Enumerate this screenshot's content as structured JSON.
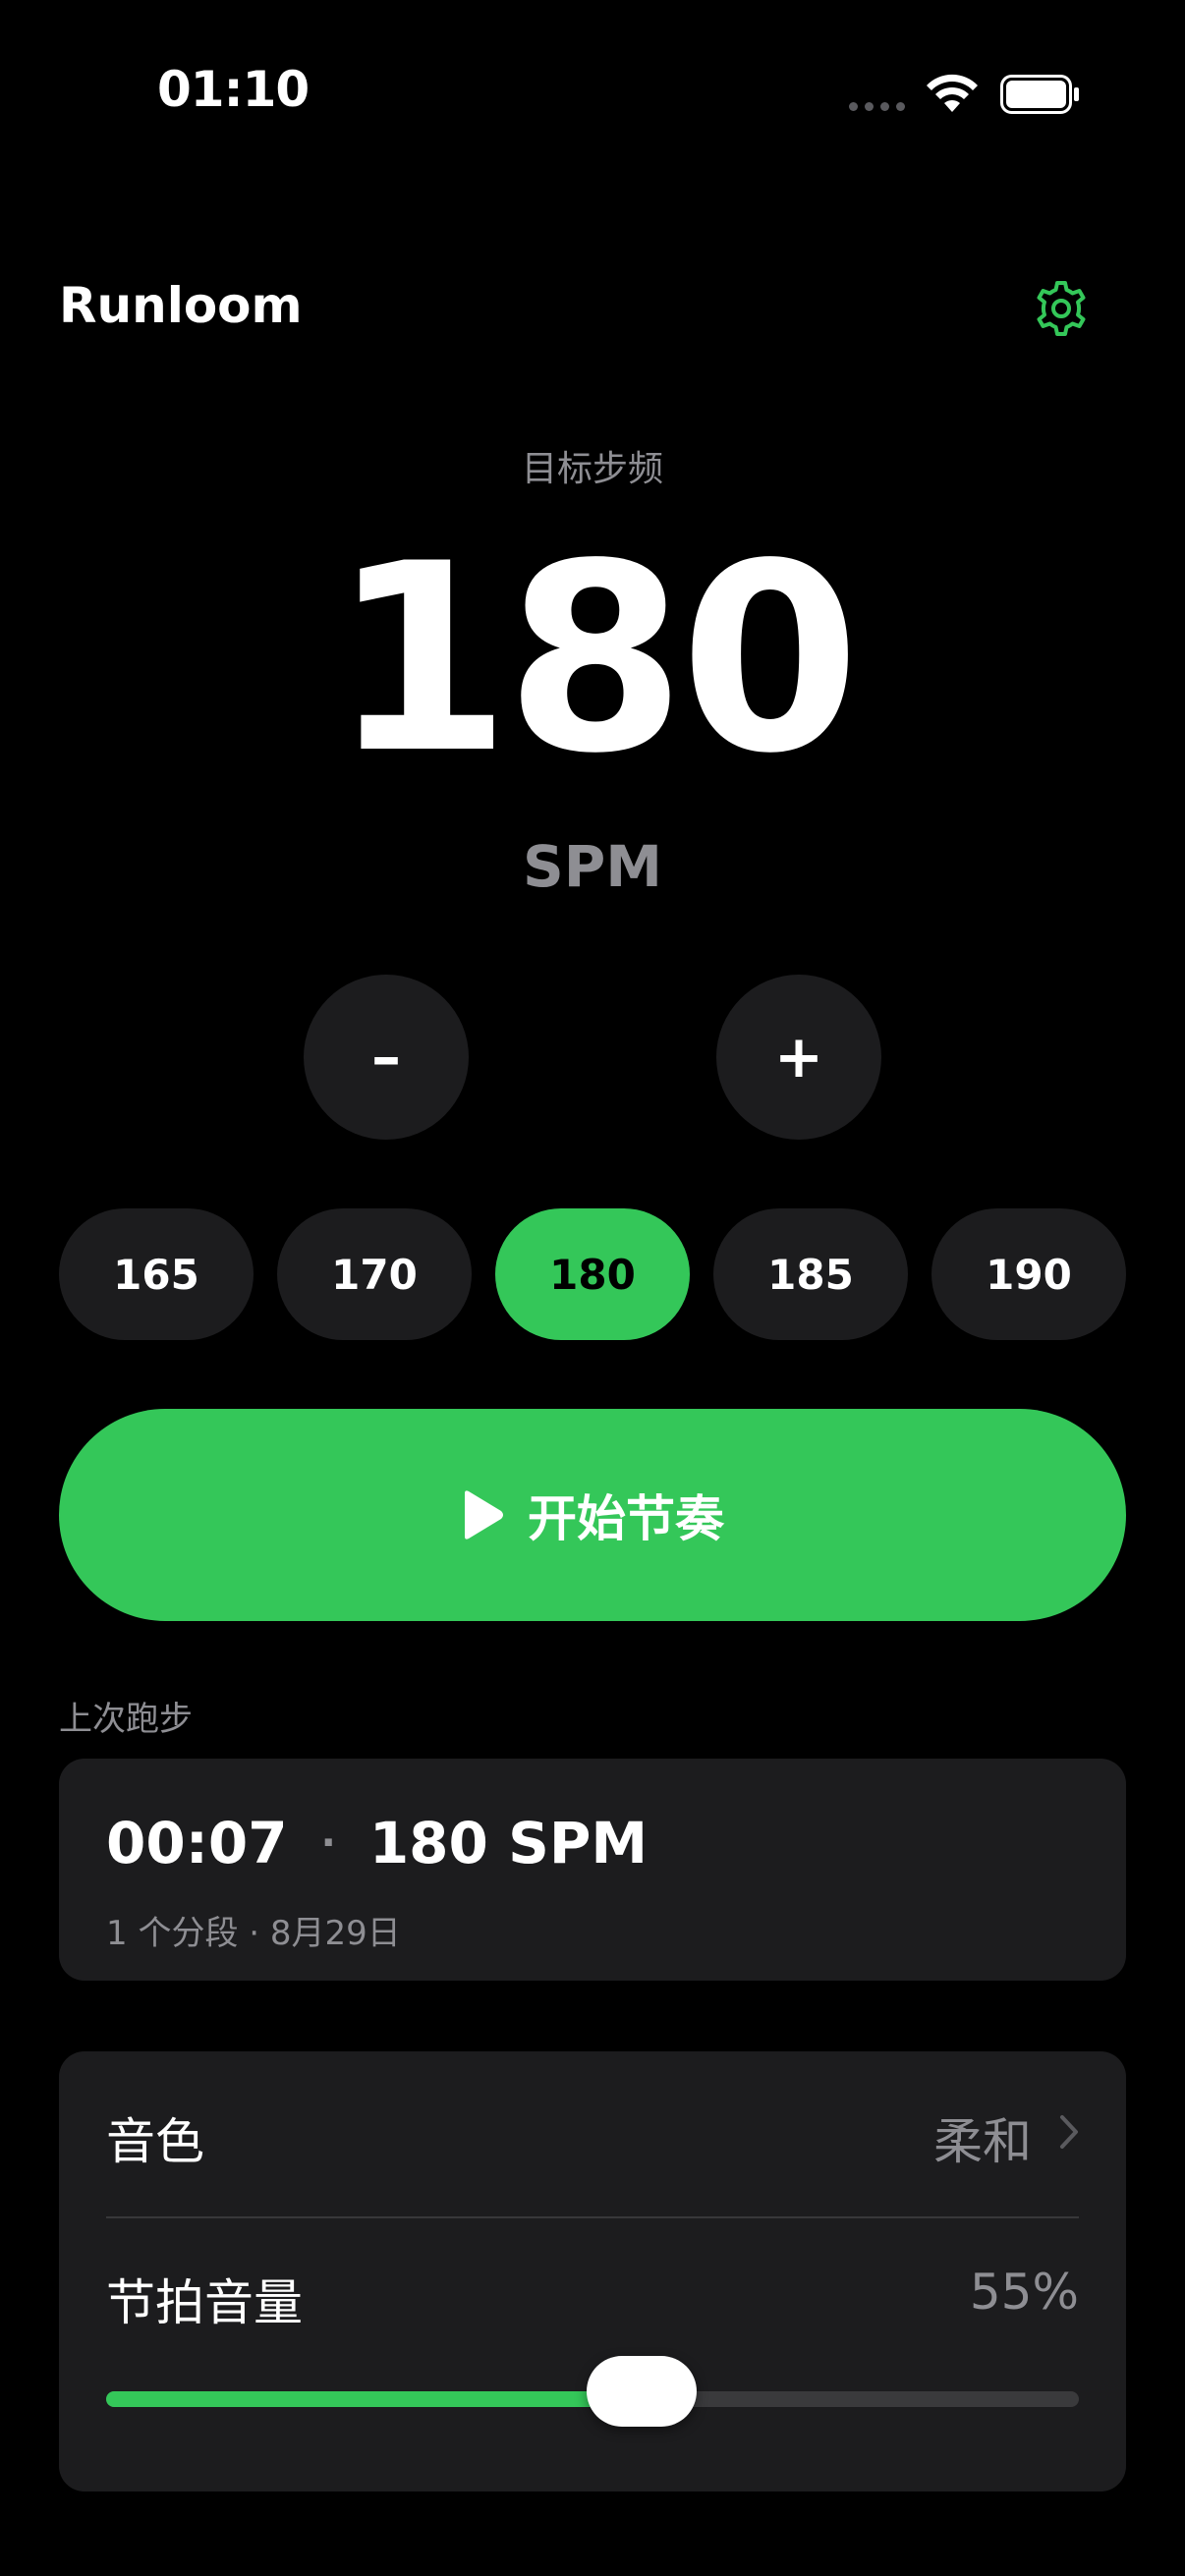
{
  "status_bar": {
    "time": "01:10",
    "icons": [
      "signal-dots-icon",
      "wifi-icon",
      "battery-icon"
    ]
  },
  "header": {
    "title": "Runloom",
    "settings_icon": "gear-icon"
  },
  "cadence": {
    "label": "目标步频",
    "value": "180",
    "unit": "SPM",
    "decrement_label": "–",
    "increment_label": "+"
  },
  "presets": [
    {
      "label": "165",
      "active": false
    },
    {
      "label": "170",
      "active": false
    },
    {
      "label": "180",
      "active": true
    },
    {
      "label": "185",
      "active": false
    },
    {
      "label": "190",
      "active": false
    }
  ],
  "start": {
    "label": "开始节奏",
    "icon": "play-icon"
  },
  "last_run": {
    "section_label": "上次跑步",
    "duration": "00:07",
    "separator": "·",
    "cadence": "180 SPM",
    "details": "1 个分段 · 8月29日"
  },
  "sound": {
    "tone_label": "音色",
    "tone_value": "柔和",
    "volume_label": "节拍音量",
    "volume_value": "55%",
    "volume_fraction": 0.55
  },
  "colors": {
    "accent": "#34c759",
    "background": "#000000",
    "card": "#1c1c1e",
    "secondary_text": "#8e8e93"
  }
}
